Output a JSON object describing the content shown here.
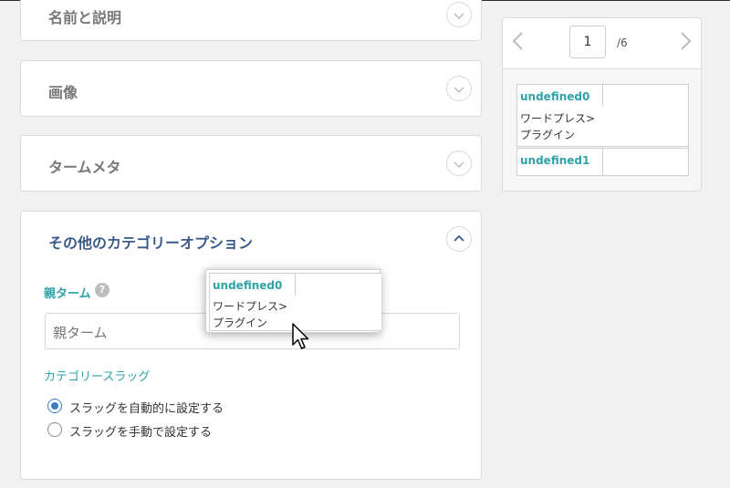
{
  "panels": {
    "name_desc": {
      "title": "名前と説明"
    },
    "image": {
      "title": "画像"
    },
    "term_meta": {
      "title": "タームメタ"
    },
    "other": {
      "title": "その他のカテゴリーオプション"
    }
  },
  "other_options": {
    "parent_label": "親ターム",
    "help_glyph": "?",
    "parent_placeholder": "親ターム",
    "slug_label": "カテゴリースラッグ",
    "radio_auto": "スラッグを自動的に設定する",
    "radio_manual": "スラッグを手動で設定する",
    "radio_selected": "auto"
  },
  "pager": {
    "current_page": "1",
    "total_pages": "/6"
  },
  "cards": [
    {
      "title": "undefined0",
      "text_line1": "ワードプレス>",
      "text_line2": "プラグイン"
    },
    {
      "title": "undefined1"
    }
  ],
  "dragging_card": {
    "title": "undefined0",
    "text_line1": "ワードプレス>",
    "text_line2": "プラグイン"
  },
  "icons": {
    "collapsed": "chevron-down-icon",
    "expanded": "chevron-up-icon",
    "prev": "chevron-left-icon",
    "next": "chevron-right-icon",
    "help": "question-icon",
    "cursor": "mouse-pointer-icon"
  },
  "colors": {
    "accent_teal": "#2ea3a7",
    "heading_blue": "#3a5a8a",
    "radio_blue": "#3b7dc4"
  }
}
